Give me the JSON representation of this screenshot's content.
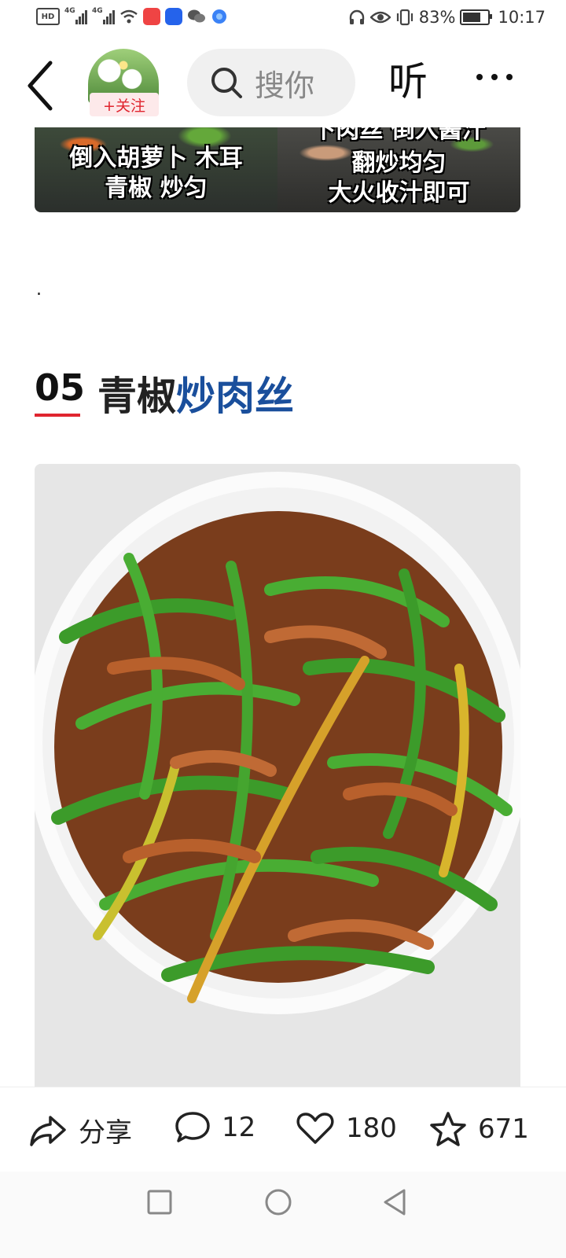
{
  "status_bar": {
    "left_icons": [
      "hd-icon",
      "signal-4g-icon",
      "signal-4g-icon",
      "wifi-icon",
      "app-icon-red",
      "app-icon-blue",
      "wechat-icon",
      "browser-icon"
    ],
    "signal_label_1": "4G",
    "signal_label_2": "4G",
    "battery_percent": "83%",
    "battery_level": 0.83,
    "time": "10:17"
  },
  "header": {
    "follow_label": "+关注",
    "search_placeholder": "搜你",
    "listen_label": "听"
  },
  "step_images": [
    {
      "caption_lines": [
        "倒入胡萝卜 木耳",
        "青椒 炒匀"
      ]
    },
    {
      "caption_lines": [
        "下肉丝 倒入酱汁",
        "翻炒均匀",
        "大火收汁即可"
      ]
    }
  ],
  "article": {
    "dot_text": ".",
    "section_number": "05",
    "section_title_plain": "青椒",
    "section_title_highlight": "炒肉丝"
  },
  "action_bar": {
    "share_label": "分享",
    "comment_count": "12",
    "like_count": "180",
    "favorite_count": "671"
  },
  "colors": {
    "accent_red": "#e0252f",
    "title_blue": "#1a4f9c"
  }
}
